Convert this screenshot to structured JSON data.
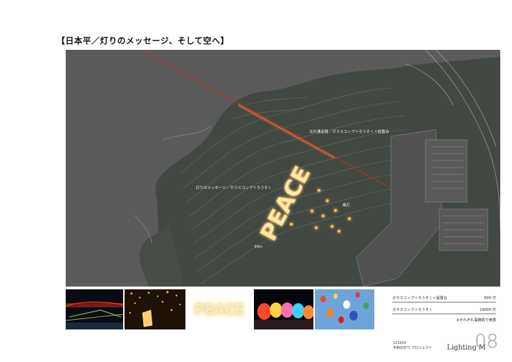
{
  "title": "【日本平／灯りのメッセージ、そして空へ】",
  "map": {
    "peace_text": "PEACE",
    "label_north": "北の湧走路／ガラスコップ＋ろうそく＋設置台",
    "label_message": "灯りのメッセージ／ガラスコップ＋ろうそく",
    "label_lanterns": "風灯",
    "label_scale": "30m"
  },
  "photos": [
    {
      "name": "night-city-lights"
    },
    {
      "name": "sky-lanterns"
    },
    {
      "name": "peace-glow",
      "text": "PEACE"
    },
    {
      "name": "balloon-glow-night"
    },
    {
      "name": "balloons-day"
    }
  ],
  "legend": {
    "rows": [
      {
        "label": "ガラスコップ＋ろうそく＋設置台",
        "count": "600 灯"
      },
      {
        "label": "ガラスコップ＋ろうそく",
        "count": "19000 灯"
      }
    ],
    "note": "※それぞれ事務局で用意"
  },
  "footer": {
    "date": "121024",
    "project": "平和の灯り プロジェクト",
    "brand": "Lighting M",
    "page": "08"
  },
  "colors": {
    "map_bg": "#5b5b5b",
    "terrain": "#414842",
    "red_line": "#d42a1a",
    "lantern": "#ffb23c",
    "peace_glow": "#ffd97a"
  }
}
